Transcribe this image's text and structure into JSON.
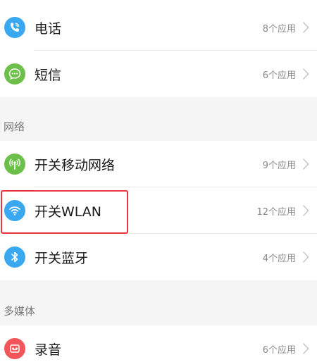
{
  "sections": {
    "network_title": "网络",
    "media_title": "多媒体"
  },
  "rows": {
    "phone": {
      "label": "电话",
      "count": "8个应用",
      "icon": "phone-icon"
    },
    "sms": {
      "label": "短信",
      "count": "6个应用",
      "icon": "message-icon"
    },
    "mobile_data": {
      "label": "开关移动网络",
      "count": "9个应用",
      "icon": "signal-icon"
    },
    "wlan": {
      "label": "开关WLAN",
      "count": "12个应用",
      "icon": "wifi-icon"
    },
    "bluetooth": {
      "label": "开关蓝牙",
      "count": "4个应用",
      "icon": "bluetooth-icon"
    },
    "recorder": {
      "label": "录音",
      "count": "6个应用",
      "icon": "recorder-icon"
    }
  },
  "colors": {
    "phone_icon": "#3aa8f0",
    "sms_icon": "#6cc04a",
    "mobile_data_icon": "#6cc04a",
    "wlan_icon": "#3aa8f0",
    "bluetooth_icon": "#3aa8f0",
    "recorder_icon": "#f2555a",
    "highlight": "#e8353a"
  }
}
